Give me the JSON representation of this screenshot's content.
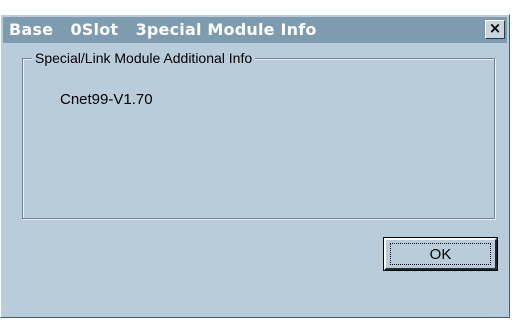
{
  "window": {
    "title": "Base   0Slot   3pecial Module Info",
    "close_glyph": "×",
    "close_icon": "close-icon"
  },
  "groupbox": {
    "label": "Special/Link Module Additional Info",
    "info_text": "Cnet99-V1.70"
  },
  "buttons": {
    "ok_label": "OK"
  },
  "colors": {
    "dialog_bg": "#b8cdd9",
    "titlebar_bg": "#7e9cb0",
    "title_text": "#ffffff"
  }
}
